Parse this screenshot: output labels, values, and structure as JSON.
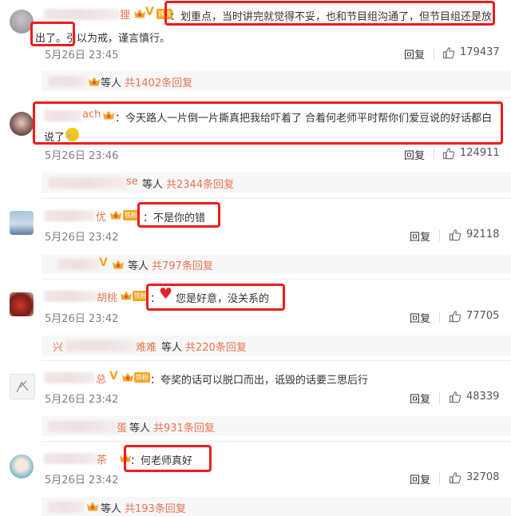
{
  "comments": [
    {
      "name_tail": "狸",
      "text1": "：划重点，当时讲完就觉得不妥，也和节目组沟通了，但节目组还是放",
      "text2": "出了。引以为戒，谨言慎行。",
      "time": "5月26日 23:45",
      "reply_label": "回复",
      "likes": "179437",
      "sub_label": "等人",
      "sub_count": "共1402条回复"
    },
    {
      "name_tail": "ach",
      "text1": "：今天路人一片倒一片撕真把我给吓着了 合着何老师平时帮你们爱豆说的好话都白",
      "text2": "说了",
      "time": "5月26日 23:46",
      "reply_label": "回复",
      "likes": "124911",
      "sub_name_tail": "se",
      "sub_label": "等人",
      "sub_count": "共2344条回复"
    },
    {
      "name_tail": "优",
      "text1": "：不是你的错",
      "time": "5月26日 23:42",
      "reply_label": "回复",
      "likes": "92118",
      "sub_label": "等人",
      "sub_count": "共797条回复"
    },
    {
      "name_tail": "胡桃",
      "text1": "：",
      "text1b": "您是好意，没关系的",
      "time": "5月26日 23:42",
      "reply_label": "回复",
      "likes": "77705",
      "sub_name_head": "兴",
      "sub_name_tail": "难难",
      "sub_label": "等人",
      "sub_count": "共220条回复"
    },
    {
      "name_tail": "总",
      "text1": "：夸奖的话可以脱口而出，诋毁的话要三思后行",
      "time": "5月26日 23:42",
      "reply_label": "回复",
      "likes": "48339",
      "sub_name_tail": "蛋",
      "sub_label": "等人",
      "sub_count": "共931条回复"
    },
    {
      "name_tail": "茶",
      "text1": "：何老师真好",
      "time": "5月26日 23:42",
      "reply_label": "回复",
      "likes": "32708",
      "sub_label": "等人",
      "sub_count": "共193条回复"
    }
  ],
  "badge_fan": "铁粉",
  "icons": {
    "like": "thumbs-up-icon",
    "vip": "vip-v-icon",
    "crown": "crown-badge-icon"
  },
  "colors": {
    "name": "#eb7350",
    "highlight": "#ee1c1c",
    "badge": "#f4a528"
  }
}
